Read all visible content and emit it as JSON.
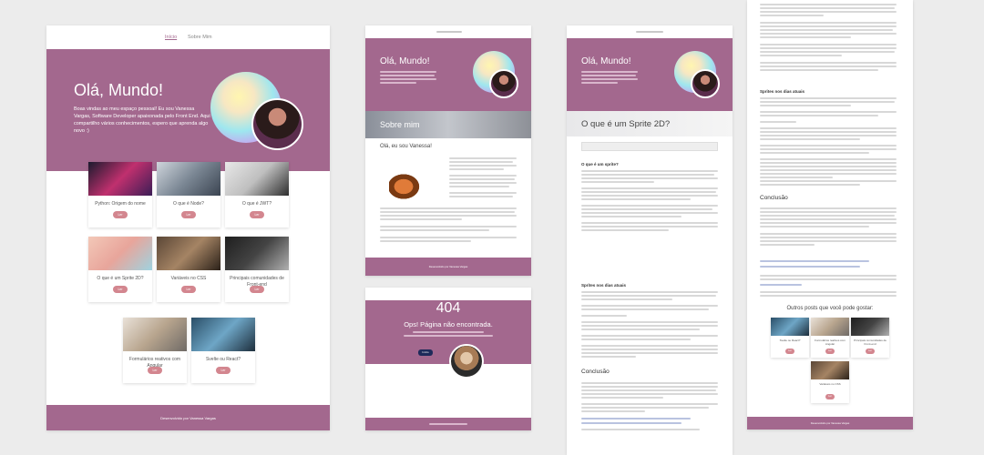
{
  "page1": {
    "nav": {
      "home": "Início",
      "about": "Sobre Mim"
    },
    "hero": {
      "title": "Olá, Mundo!",
      "subtitle": "Boas vindas ao meu espaço pessoal! Eu sou Vanessa Vargas, Software Developer apaixonada pelo Front End. Aqui compartilho vários conhecimentos, espero que aprenda algo novo :)"
    },
    "posts": [
      {
        "title": "Python: Origem do nome",
        "button": "Ler"
      },
      {
        "title": "O que é Node?",
        "button": "Ler"
      },
      {
        "title": "O que é JWT?",
        "button": "Ler"
      },
      {
        "title": "O que é um Sprite 2D?",
        "button": "Ler"
      },
      {
        "title": "Variáveis no CSS",
        "button": "Ler"
      },
      {
        "title": "Principais comunidades de Front-end",
        "button": "Ler"
      },
      {
        "title": "Formulários reativos com Angular",
        "button": "Ler"
      },
      {
        "title": "Svelte ou React?",
        "button": "Ler"
      }
    ],
    "footer": "Desenvolvido por Vanessa Vargas",
    "colors": {
      "accent": "#a3688e",
      "button": "#d3868f"
    }
  },
  "page2": {
    "hero_title": "Olá, Mundo!",
    "about_title": "Sobre mim",
    "about_heading": "Olá, eu sou Vanessa!",
    "footer": "Desenvolvido por Vanessa Vargas"
  },
  "page3": {
    "code": "404",
    "title": "Ops! Página não encontrada.",
    "button": "Início"
  },
  "page4": {
    "hero_title": "Olá, Mundo!",
    "post_title": "O que é um Sprite 2D?",
    "section_1": "O que é um sprite?",
    "section_2": "Sprites nos dias atuais",
    "section_3": "Conclusão",
    "section_4": "Sprites nos dias atuais",
    "section_5": "Conclusão",
    "more_posts_title": "Outros posts que você pode gostar:",
    "more_posts": [
      {
        "title": "Svelte ou React?",
        "button": "Ler"
      },
      {
        "title": "Formulários reativos com Angular",
        "button": "Ler"
      },
      {
        "title": "Principais comunidades de Front-end",
        "button": "Ler"
      },
      {
        "title": "Variáveis no CSS",
        "button": "Ler"
      }
    ],
    "footer": "Desenvolvido por Vanessa Vargas"
  }
}
